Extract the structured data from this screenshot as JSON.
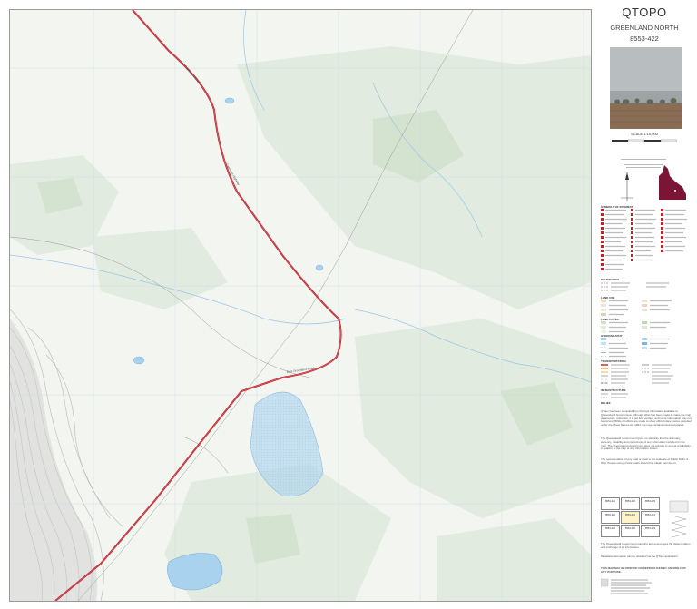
{
  "map_title": "QTOPO",
  "sheet_name": "GREENLAND NORTH",
  "sheet_code": "8553-422",
  "scale": "SCALE 1:10,000",
  "legend": {
    "symbols_head": "SYMBOLS OF INTEREST",
    "boundaries_head": "BOUNDARIES",
    "land_use_head": "LAND USE",
    "land_cover_head": "LAND COVER",
    "hydrography_head": "HYDROGRAPHY",
    "transportation_head": "TRANSPORTATION",
    "infrastructure_head": "INFRASTRUCTURE",
    "relief_head": "RELIEF"
  },
  "road_labels": [
    "Capricorn Highway",
    "East Greenland Road"
  ],
  "colors": {
    "highway": "#c0202a",
    "water": "#a9d2ee",
    "vegetation": "#dfeadc",
    "state_maroon": "#7a1535"
  },
  "notes": {
    "disclaimer": "QTopo has been compiled from the best information available to Queensland Government. Although effort has been made to make the map as accurate, reference, it is not fully verified, and some information may not be current. While all efforts are made to show official place names gazetted under the Place Names Act 1994, the map contains unnamed places.",
    "liability": "The Queensland Government gives no warranty that the accuracy, currency, reliability and correctness of any information included on the map. The Queensland Government does not warrant or accept any liability in relation to the map or any information shown.",
    "access": "The representation of any road or track is not evidence of Public Right of Way. People using private roads should first obtain permission.",
    "feedback": "The Queensland Government supports and encourages the dissemination and exchange of its information.",
    "metadata": "Metadata information can be obtained via the QTopo application.",
    "print": "THIS MAP MAY BE PRINTED OR REPRODUCED BY ANYONE FOR ANY PURPOSE."
  },
  "index_sheets": [
    "8553-421",
    "8553-422",
    "8553-423",
    "8553-411",
    "8553-412",
    "8553-413",
    "8553-321",
    "8553-322",
    "8553-323"
  ]
}
